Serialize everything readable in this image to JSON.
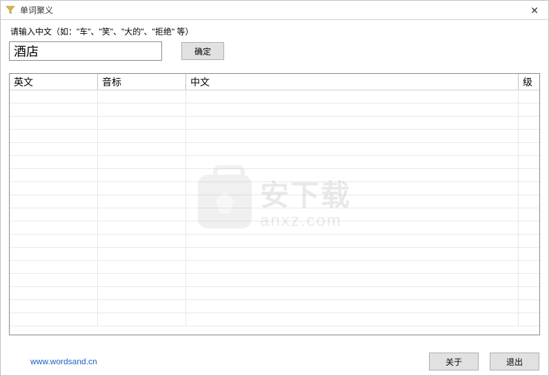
{
  "window": {
    "title": "单词聚义",
    "close_symbol": "✕"
  },
  "prompt": "请输入中文（如：\"车\"、\"笑\"、\"大的\"、\"拒绝\"  等）",
  "input": {
    "value": "酒店"
  },
  "buttons": {
    "confirm": "确定",
    "about": "关于",
    "exit": "退出"
  },
  "table": {
    "headers": {
      "english": "英文",
      "phonetic": "音标",
      "chinese": "中文",
      "level": "级"
    },
    "rows": []
  },
  "footer": {
    "link_text": "www.wordsand.cn"
  },
  "watermark": {
    "line1": "安下载",
    "line2": "anxz.com"
  }
}
